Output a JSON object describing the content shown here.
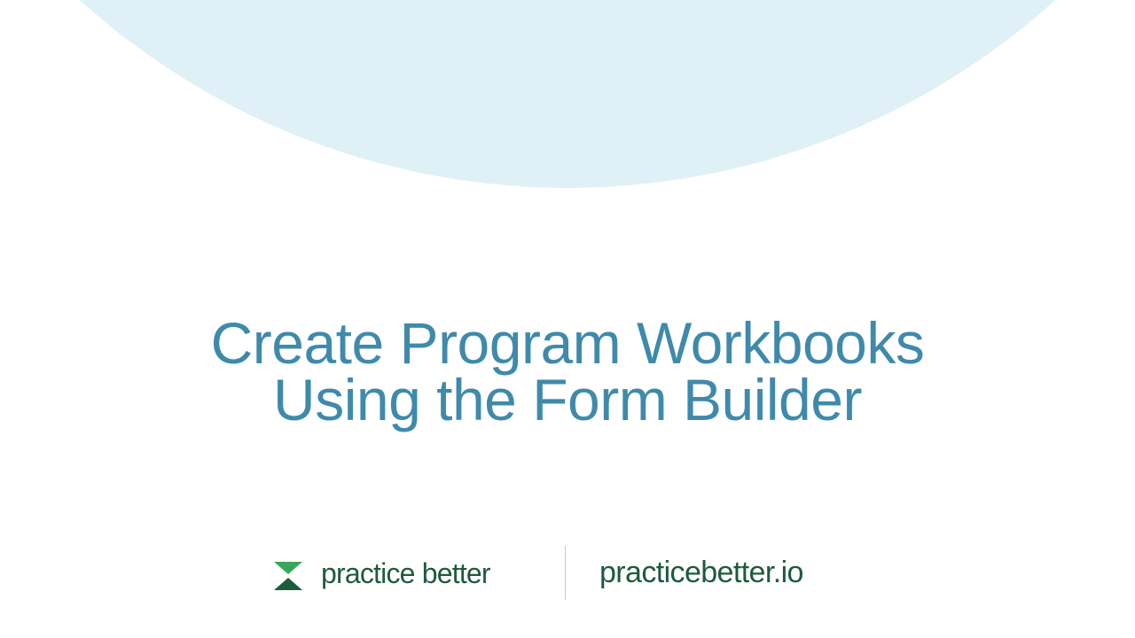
{
  "title": {
    "line1": "Create Program Workbooks",
    "line2": "Using the Form Builder"
  },
  "footer": {
    "brand_name": "practice better",
    "website": "practicebetter.io",
    "logo_icon": "hourglass-logo-icon"
  },
  "colors": {
    "background": "#ffffff",
    "arc": "#dff0f6",
    "title": "#3f8aab",
    "brand_dark_green": "#1f5a3d",
    "brand_light_green": "#3aa55c",
    "divider": "#c9c9c9"
  }
}
